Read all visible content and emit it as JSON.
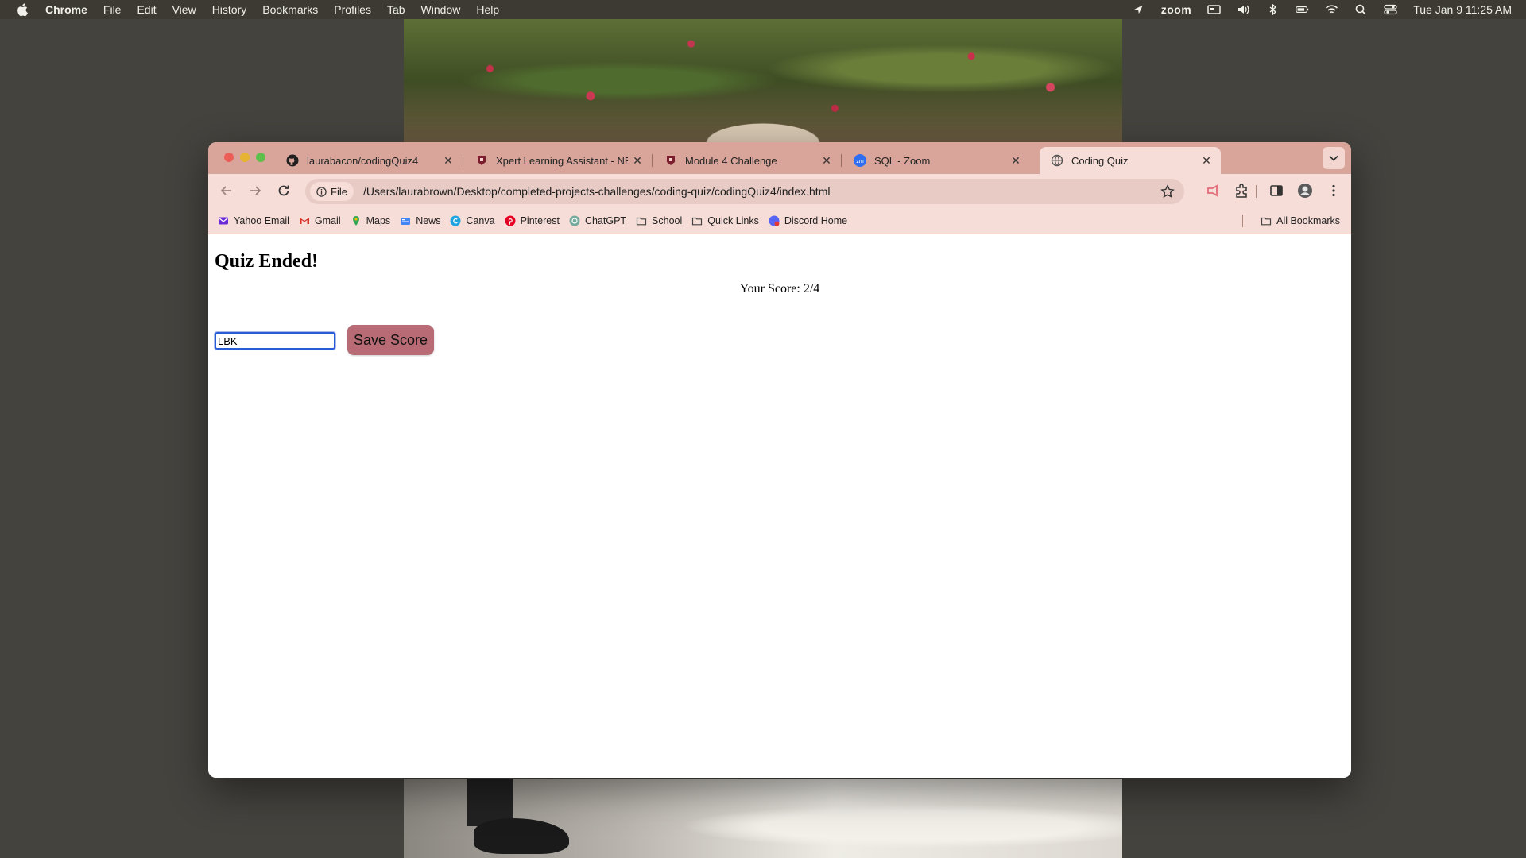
{
  "menubar": {
    "app_name": "Chrome",
    "items": [
      "File",
      "Edit",
      "View",
      "History",
      "Bookmarks",
      "Profiles",
      "Tab",
      "Window",
      "Help"
    ],
    "zoom_label": "zoom",
    "datetime": "Tue Jan 9  11:25 AM"
  },
  "tabs": [
    {
      "title": "laurabacon/codingQuiz4",
      "icon": "github-icon"
    },
    {
      "title": "Xpert Learning Assistant - NE",
      "icon": "edx-icon"
    },
    {
      "title": "Module 4 Challenge",
      "icon": "edx-icon"
    },
    {
      "title": "SQL - Zoom",
      "icon": "zoom-icon"
    },
    {
      "title": "Coding Quiz",
      "icon": "globe-icon",
      "active": true
    }
  ],
  "toolbar": {
    "chip_label": "File",
    "url": "/Users/laurabrown/Desktop/completed-projects-challenges/coding-quiz/codingQuiz4/index.html"
  },
  "bookmarks": {
    "items": [
      "Yahoo Email",
      "Gmail",
      "Maps",
      "News",
      "Canva",
      "Pinterest",
      "ChatGPT",
      "School",
      "Quick Links",
      "Discord Home"
    ],
    "all_label": "All Bookmarks"
  },
  "page": {
    "heading": "Quiz Ended!",
    "score_text": "Your Score: 2/4",
    "initials_value": "LBK",
    "save_label": "Save Score"
  },
  "colors": {
    "tabstrip": "#d9a59a",
    "toolbar": "#f6ddd7",
    "save_button": "#b86b74"
  }
}
